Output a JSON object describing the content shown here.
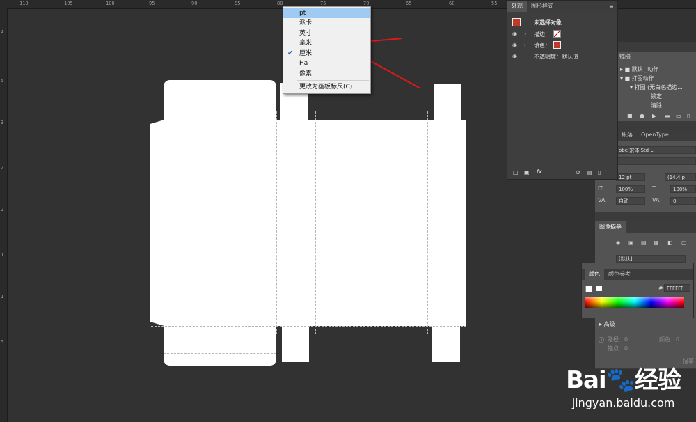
{
  "ruler": {
    "top_labels": [
      "110",
      "105",
      "100",
      "95",
      "90",
      "85",
      "80",
      "75",
      "70",
      "65",
      "60",
      "55",
      "50"
    ],
    "left_labels": [
      "4",
      "5",
      "3",
      "2",
      "2",
      "1",
      "1",
      "5"
    ]
  },
  "unit_menu": {
    "items": [
      {
        "label": "pt",
        "selected": true,
        "checked": false
      },
      {
        "label": "派卡",
        "selected": false,
        "checked": false
      },
      {
        "label": "英寸",
        "selected": false,
        "checked": false
      },
      {
        "label": "毫米",
        "selected": false,
        "checked": false
      },
      {
        "label": "厘米",
        "selected": false,
        "checked": true
      },
      {
        "label": "Ha",
        "selected": false,
        "checked": false
      },
      {
        "label": "像素",
        "selected": false,
        "checked": false
      }
    ],
    "footer_item": "更改为画板标尺(C)"
  },
  "appearance_panel": {
    "tabs": [
      "外观",
      "图形样式"
    ],
    "header": "未选择对象",
    "rows": [
      {
        "label": "描边：",
        "swatch": "stroke"
      },
      {
        "label": "填色：",
        "swatch": "fill"
      }
    ],
    "opacity": "不透明度：默认值",
    "footer_fx": "fx."
  },
  "actions_panel": {
    "title": "链接",
    "items": [
      "默认 _动作",
      "打图动作",
      "打图 (无白色描边...",
      "锁定",
      "清除"
    ]
  },
  "character_panel": {
    "tabs": [
      "段落",
      "OpenType"
    ],
    "font": "obe 宋体 Std L",
    "size": "12 pt",
    "leading": "(14.4 p",
    "vscale": "100%",
    "hscale": "100%",
    "kerning": "自动",
    "tracking": "0"
  },
  "image_trace_panel": {
    "title": "图像描摹",
    "preset": "[默认]"
  },
  "color_panel": {
    "tabs": [
      "颜色",
      "颜色参考"
    ],
    "hex_label": "#",
    "hex_value": "FFFFFF"
  },
  "advanced_panel": {
    "label": "高级",
    "paths_label": "路径：0",
    "anchors_label": "锚点：0",
    "colors_label": "颜色：0",
    "apply_label": "描摹"
  },
  "watermark": {
    "brand": "Bai",
    "brand2": "经验",
    "url": "jingyan.baidu.com"
  },
  "colors": {
    "canvas": "#323232",
    "panel": "#535353",
    "menu_highlight": "#9fcbf2",
    "arrow": "#e01818",
    "swatch_red": "#c0392b"
  }
}
